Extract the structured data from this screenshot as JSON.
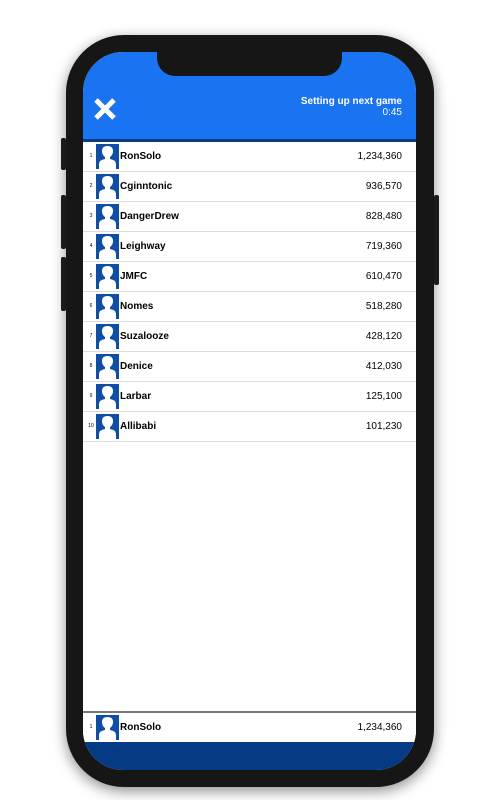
{
  "header": {
    "close_icon": "close-icon",
    "status_title": "Setting up next game",
    "countdown": "0:45",
    "accent_color": "#1a73f0"
  },
  "leaderboard": {
    "rows": [
      {
        "rank": "1",
        "name": "RonSolo",
        "score": "1,234,360",
        "avatar_icon": "user-avatar-icon"
      },
      {
        "rank": "2",
        "name": "Cginntonic",
        "score": "936,570",
        "avatar_icon": "user-avatar-icon"
      },
      {
        "rank": "3",
        "name": "DangerDrew",
        "score": "828,480",
        "avatar_icon": "user-avatar-icon"
      },
      {
        "rank": "4",
        "name": "Leighway",
        "score": "719,360",
        "avatar_icon": "user-avatar-icon"
      },
      {
        "rank": "5",
        "name": "JMFC",
        "score": "610,470",
        "avatar_icon": "user-avatar-icon"
      },
      {
        "rank": "6",
        "name": "Nomes",
        "score": "518,280",
        "avatar_icon": "user-avatar-icon"
      },
      {
        "rank": "7",
        "name": "Suzalooze",
        "score": "428,120",
        "avatar_icon": "user-avatar-icon"
      },
      {
        "rank": "8",
        "name": "Denice",
        "score": "412,030",
        "avatar_icon": "user-avatar-icon"
      },
      {
        "rank": "9",
        "name": "Larbar",
        "score": "125,100",
        "avatar_icon": "user-avatar-icon"
      },
      {
        "rank": "10",
        "name": "Allibabi",
        "score": "101,230",
        "avatar_icon": "user-avatar-icon"
      }
    ]
  },
  "current_player": {
    "rank": "1",
    "name": "RonSolo",
    "score": "1,234,360",
    "avatar_icon": "user-avatar-icon"
  },
  "colors": {
    "header_blue": "#1a73f0",
    "dark_blue": "#053a85",
    "avatar_blue": "#0f4ea3"
  }
}
